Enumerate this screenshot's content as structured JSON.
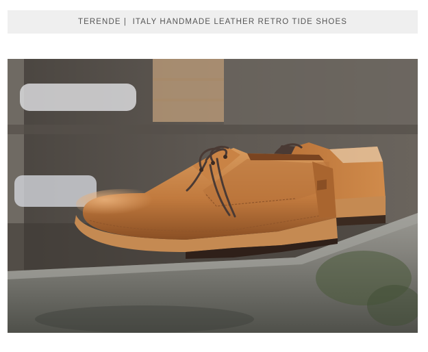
{
  "header": {
    "brand": "TERENDE",
    "separator": "|",
    "title": "ITALY HANDMADE LEATHER RETRO TIDE SHOES",
    "full_text": "TERENDE |  ITALY HANDMADE LEATHER RETRO TIDE SHOES"
  },
  "product_image": {
    "subject": "tan-leather-derby-shoes",
    "colors": {
      "leather": "#c17a3e",
      "leather_highlight": "#d99a5c",
      "leather_shadow": "#8a4f24",
      "sole": "#c58a52",
      "laces": "#4a3a34",
      "stone_ledge": "#8b8b86",
      "background_wall": "#5a5550"
    }
  }
}
